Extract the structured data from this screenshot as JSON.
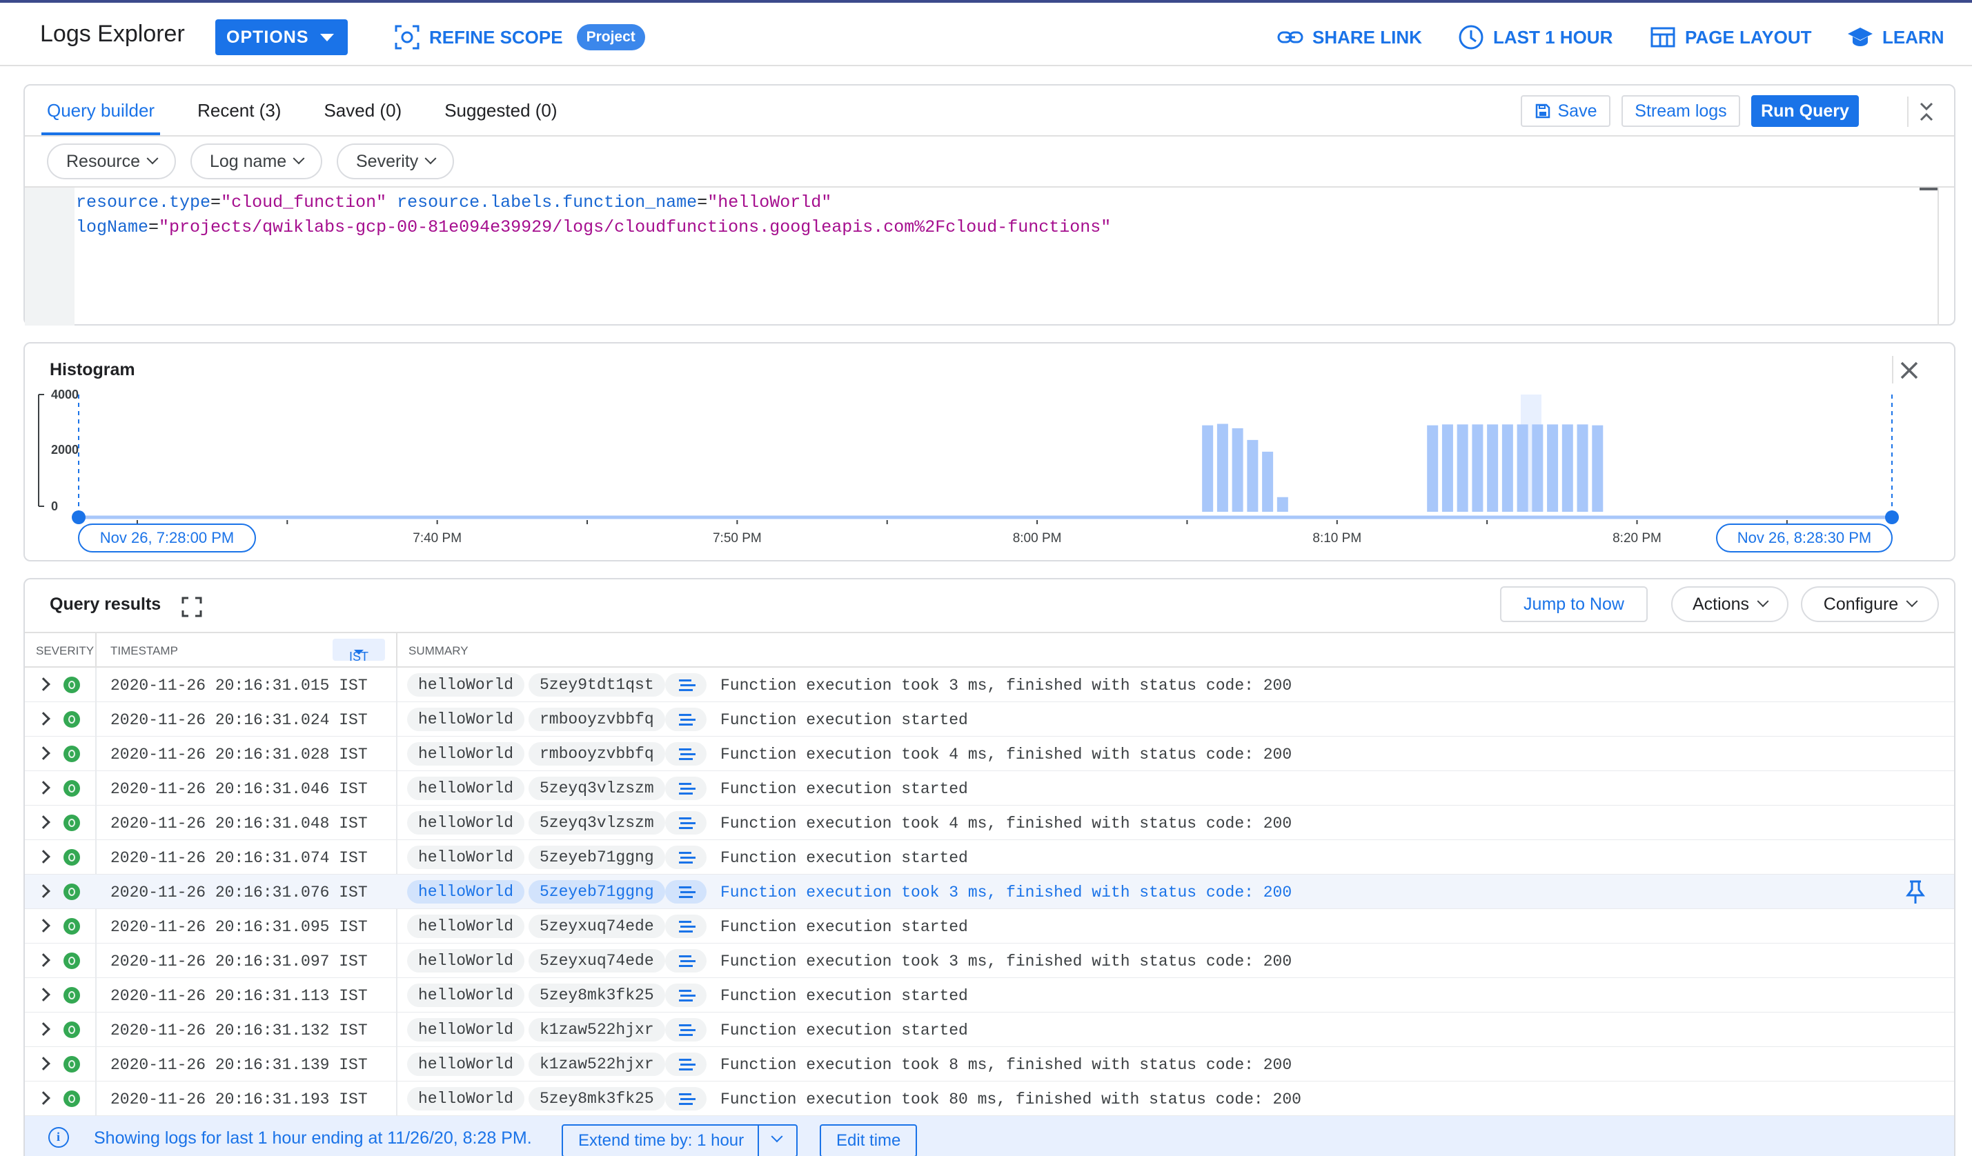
{
  "header": {
    "title": "Logs Explorer",
    "options_label": "OPTIONS",
    "refine_scope_label": "REFINE SCOPE",
    "project_chip": "Project",
    "share_link_label": "SHARE LINK",
    "time_range_label": "LAST 1 HOUR",
    "page_layout_label": "PAGE LAYOUT",
    "learn_label": "LEARN",
    "accent_color": "#1a73e8"
  },
  "query_builder": {
    "tabs": [
      {
        "label": "Query builder",
        "active": true
      },
      {
        "label": "Recent (3)",
        "active": false
      },
      {
        "label": "Saved (0)",
        "active": false
      },
      {
        "label": "Suggested (0)",
        "active": false
      }
    ],
    "save_label": "Save",
    "stream_logs_label": "Stream logs",
    "run_query_label": "Run Query",
    "filters": [
      "Resource",
      "Log name",
      "Severity"
    ],
    "query_lines": [
      [
        {
          "t": "resource.type",
          "c": "k"
        },
        {
          "t": "=",
          "c": "o"
        },
        {
          "t": "\"cloud_function\"",
          "c": "s"
        },
        {
          "t": " resource.labels.function_name",
          "c": "k"
        },
        {
          "t": "=",
          "c": "o"
        },
        {
          "t": "\"helloWorld\"",
          "c": "s"
        }
      ],
      [
        {
          "t": "logName",
          "c": "k"
        },
        {
          "t": "=",
          "c": "o"
        },
        {
          "t": "\"projects/qwiklabs-gcp-00-81e094e39929/logs/cloudfunctions.googleapis.com%2Fcloud-functions\"",
          "c": "s"
        }
      ]
    ]
  },
  "histogram": {
    "title": "Histogram",
    "y_ticks": [
      "4000",
      "2000",
      "0"
    ],
    "x_ticks": [
      "7:40 PM",
      "7:50 PM",
      "8:00 PM",
      "8:10 PM",
      "8:20 PM"
    ],
    "start_label": "Nov 26, 7:28:00 PM",
    "end_label": "Nov 26, 8:28:30 PM",
    "bar_color": "#a8c7fa",
    "chart_data": {
      "type": "bar",
      "x_unit": "minutes after 7:28:00 PM",
      "ylim": [
        0,
        4000
      ],
      "bars": [
        {
          "x": 37.5,
          "y": 2950
        },
        {
          "x": 38.0,
          "y": 3000
        },
        {
          "x": 38.5,
          "y": 2850
        },
        {
          "x": 39.0,
          "y": 2450
        },
        {
          "x": 39.5,
          "y": 2050
        },
        {
          "x": 40.0,
          "y": 500
        },
        {
          "x": 45.0,
          "y": 2950
        },
        {
          "x": 45.5,
          "y": 2980
        },
        {
          "x": 46.0,
          "y": 2980
        },
        {
          "x": 46.5,
          "y": 2980
        },
        {
          "x": 47.0,
          "y": 2980
        },
        {
          "x": 47.5,
          "y": 2980
        },
        {
          "x": 48.0,
          "y": 2980
        },
        {
          "x": 48.5,
          "y": 2980
        },
        {
          "x": 49.0,
          "y": 2980
        },
        {
          "x": 49.5,
          "y": 2980
        },
        {
          "x": 50.0,
          "y": 2980
        },
        {
          "x": 50.5,
          "y": 2950
        }
      ]
    }
  },
  "results": {
    "title": "Query results",
    "jump_label": "Jump to Now",
    "actions_label": "Actions",
    "configure_label": "Configure",
    "columns": {
      "severity": "SEVERITY",
      "timestamp": "TIMESTAMP",
      "tz": "IST",
      "summary": "SUMMARY"
    },
    "rows": [
      {
        "ts": "2020-11-26 20:16:31.015 IST",
        "fn": "helloWorld",
        "id": "5zey9tdt1qst",
        "msg": "Function execution took 3 ms, finished with status code: 200"
      },
      {
        "ts": "2020-11-26 20:16:31.024 IST",
        "fn": "helloWorld",
        "id": "rmbooyzvbbfq",
        "msg": "Function execution started"
      },
      {
        "ts": "2020-11-26 20:16:31.028 IST",
        "fn": "helloWorld",
        "id": "rmbooyzvbbfq",
        "msg": "Function execution took 4 ms, finished with status code: 200"
      },
      {
        "ts": "2020-11-26 20:16:31.046 IST",
        "fn": "helloWorld",
        "id": "5zeyq3vlzszm",
        "msg": "Function execution started"
      },
      {
        "ts": "2020-11-26 20:16:31.048 IST",
        "fn": "helloWorld",
        "id": "5zeyq3vlzszm",
        "msg": "Function execution took 4 ms, finished with status code: 200"
      },
      {
        "ts": "2020-11-26 20:16:31.074 IST",
        "fn": "helloWorld",
        "id": "5zeyeb71ggng",
        "msg": "Function execution started"
      },
      {
        "ts": "2020-11-26 20:16:31.076 IST",
        "fn": "helloWorld",
        "id": "5zeyeb71ggng",
        "msg": "Function execution took 3 ms, finished with status code: 200",
        "highlighted": true
      },
      {
        "ts": "2020-11-26 20:16:31.095 IST",
        "fn": "helloWorld",
        "id": "5zeyxuq74ede",
        "msg": "Function execution started"
      },
      {
        "ts": "2020-11-26 20:16:31.097 IST",
        "fn": "helloWorld",
        "id": "5zeyxuq74ede",
        "msg": "Function execution took 3 ms, finished with status code: 200"
      },
      {
        "ts": "2020-11-26 20:16:31.113 IST",
        "fn": "helloWorld",
        "id": "5zey8mk3fk25",
        "msg": "Function execution started"
      },
      {
        "ts": "2020-11-26 20:16:31.132 IST",
        "fn": "helloWorld",
        "id": "k1zaw522hjxr",
        "msg": "Function execution started"
      },
      {
        "ts": "2020-11-26 20:16:31.139 IST",
        "fn": "helloWorld",
        "id": "k1zaw522hjxr",
        "msg": "Function execution took 8 ms, finished with status code: 200"
      },
      {
        "ts": "2020-11-26 20:16:31.193 IST",
        "fn": "helloWorld",
        "id": "5zey8mk3fk25",
        "msg": "Function execution took 80 ms, finished with status code: 200"
      }
    ],
    "footer_text": "Showing logs for last 1 hour ending at 11/26/20, 8:28 PM.",
    "extend_label": "Extend time by: 1 hour",
    "edit_time_label": "Edit time"
  }
}
